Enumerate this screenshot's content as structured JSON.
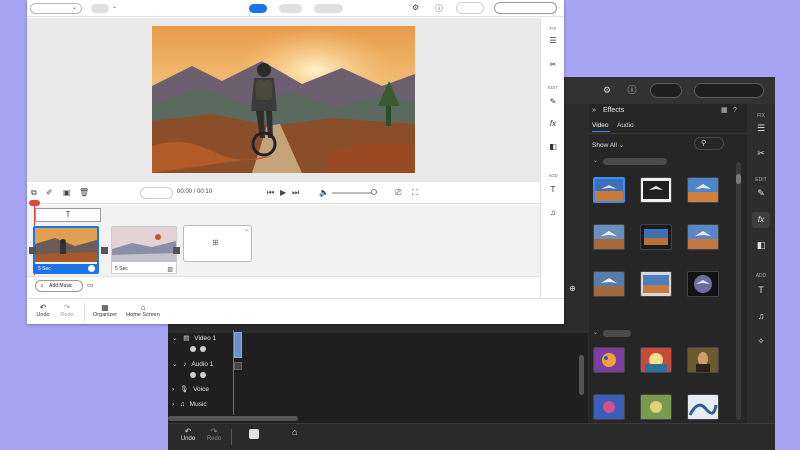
{
  "colors": {
    "accent": "#3b8cff",
    "background": "#a7a4f4",
    "dark": "#2b2b2b"
  },
  "dark_window": {
    "effects": {
      "title": "Effects",
      "tabs": [
        {
          "label": "Video"
        },
        {
          "label": "Audio"
        }
      ],
      "show_all": "Show All"
    },
    "rail": {
      "fix": "FIX",
      "edit": "EDIT",
      "add": "ADD",
      "fx": "fx"
    },
    "timeline": {
      "tracks": [
        {
          "label": "Video 1"
        },
        {
          "label": "Audio 1"
        },
        {
          "label": "Voice"
        },
        {
          "label": "Music"
        }
      ]
    },
    "bottom": {
      "undo": "Undo",
      "redo": "Redo"
    }
  },
  "light_window": {
    "rail": {
      "fix": "FIX",
      "edit": "EDIT",
      "add": "ADD",
      "fx": "fx"
    },
    "controls": {
      "time": "00:00 / 00:10"
    },
    "clips": [
      {
        "duration": "5 Sec"
      },
      {
        "duration": "5 Sec"
      }
    ],
    "add_music": "Add Music",
    "bottom": {
      "undo": "Undo",
      "redo": "Redo",
      "organizer": "Organizer",
      "home": "Home Screen"
    }
  }
}
